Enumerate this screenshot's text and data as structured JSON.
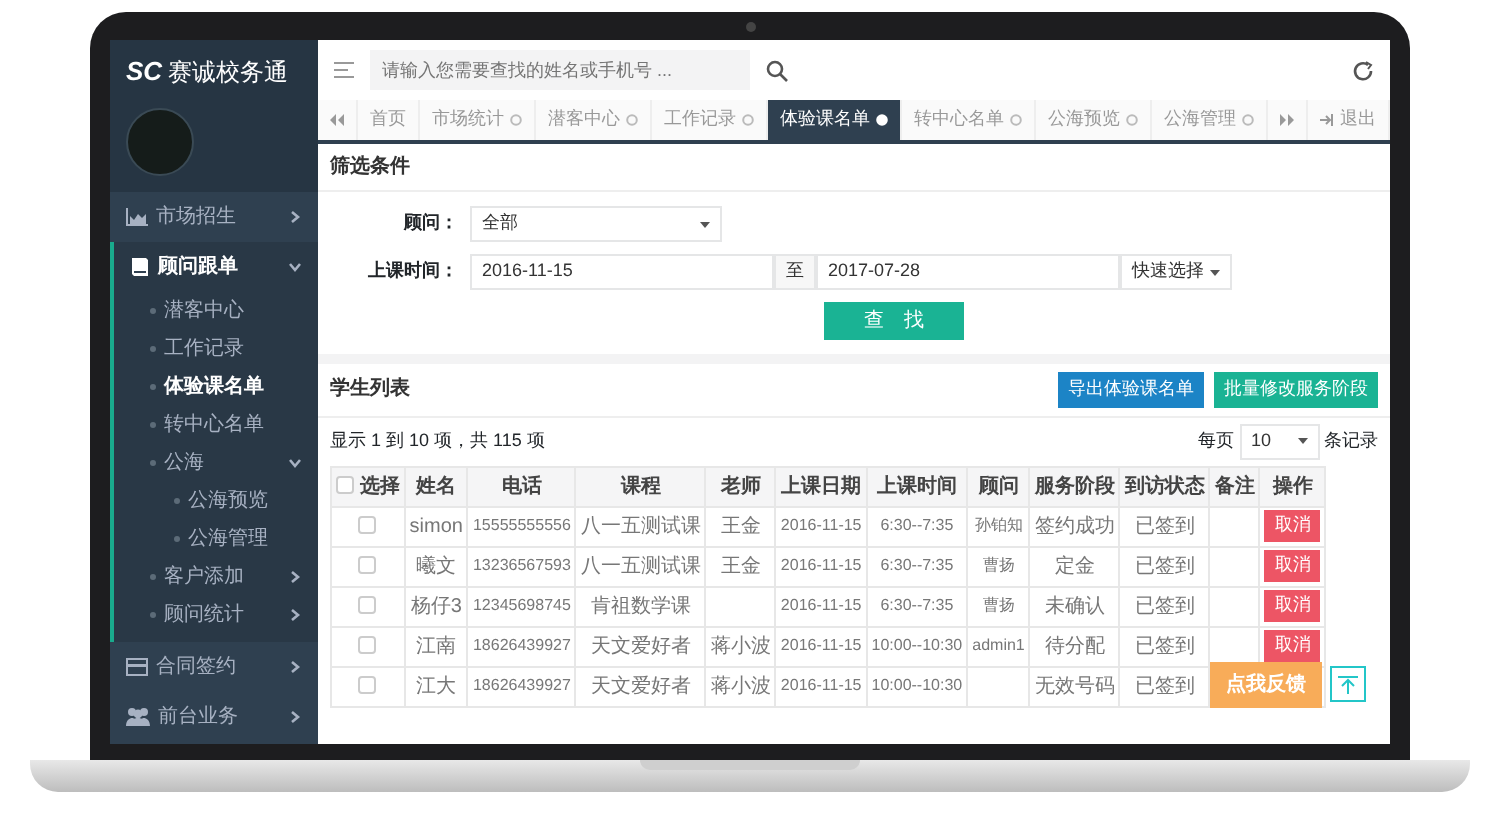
{
  "sidebar": {
    "logo_mark": "SC",
    "app_name": "赛诚校务通",
    "items": [
      {
        "label": "市场招生",
        "kind": "group",
        "expanded": false
      },
      {
        "label": "顾问跟单",
        "kind": "group",
        "expanded": true,
        "children": [
          {
            "label": "潜客中心",
            "selected": false
          },
          {
            "label": "工作记录",
            "selected": false
          },
          {
            "label": "体验课名单",
            "selected": true
          },
          {
            "label": "转中心名单",
            "selected": false
          },
          {
            "label": "公海",
            "expanded": true,
            "selected": false,
            "children": [
              {
                "label": "公海预览",
                "selected": false
              },
              {
                "label": "公海管理",
                "selected": false
              }
            ]
          },
          {
            "label": "客户添加",
            "expanded": false,
            "selected": false
          },
          {
            "label": "顾问统计",
            "expanded": false,
            "selected": false
          }
        ]
      },
      {
        "label": "合同签约",
        "kind": "group",
        "expanded": false
      },
      {
        "label": "前台业务",
        "kind": "group",
        "expanded": false
      }
    ]
  },
  "topbar": {
    "search": {
      "placeholder": "请输入您需要查找的姓名或手机号 ..."
    }
  },
  "tabs": [
    {
      "label": "首页",
      "selected": false,
      "closable": false
    },
    {
      "label": "市场统计",
      "selected": false,
      "closable": true
    },
    {
      "label": "潜客中心",
      "selected": false,
      "closable": true
    },
    {
      "label": "工作记录",
      "selected": false,
      "closable": true
    },
    {
      "label": "体验课名单",
      "selected": true,
      "closable": true
    },
    {
      "label": "转中心名单",
      "selected": false,
      "closable": true
    },
    {
      "label": "公海预览",
      "selected": false,
      "closable": true
    },
    {
      "label": "公海管理",
      "selected": false,
      "closable": true
    }
  ],
  "logout": "退出",
  "filter": {
    "title": "筛选条件",
    "advisor_label": "顾问：",
    "advisor_value": "全部",
    "time_label": "上课时间：",
    "date_from": "2016-11-15",
    "date_sep": "至",
    "date_to": "2017-07-28",
    "quick_select": "快速选择",
    "search_button": "查　找"
  },
  "list": {
    "title": "学生列表",
    "buttons": [
      {
        "label": "导出体验课名单",
        "kind": "primary"
      },
      {
        "label": "批量修改服务阶段",
        "kind": "success"
      }
    ],
    "summary": "显示 1 到 10 项，共 115 项",
    "per_page_label": "每页",
    "per_page": "10",
    "per_page_suffix": "条记录",
    "table": {
      "select_all_checked": false,
      "columns": [
        "选择",
        "姓名",
        "电话",
        "课程",
        "老师",
        "上课日期",
        "上课时间",
        "顾问",
        "服务阶段",
        "到访状态",
        "备注",
        "操作"
      ],
      "rows": [
        {
          "checked": false,
          "name": "simon",
          "phone": "15555555556",
          "course": "八一五测试课",
          "teacher": "王金",
          "date": "2016-11-15",
          "time": "6:30--7:35",
          "advisor": "孙铂知",
          "stage": "签约成功",
          "status": "已签到",
          "action": "取消"
        },
        {
          "checked": false,
          "name": "曦文",
          "phone": "13236567593",
          "course": "八一五测试课",
          "teacher": "王金",
          "date": "2016-11-15",
          "time": "6:30--7:35",
          "advisor": "曹扬",
          "stage": "定金",
          "status": "已签到",
          "action": "取消"
        },
        {
          "checked": false,
          "name": "杨仔3",
          "phone": "12345698745",
          "course": "肯祖数学课",
          "teacher": "",
          "date": "2016-11-15",
          "time": "6:30--7:35",
          "advisor": "曹扬",
          "stage": "未确认",
          "status": "已签到",
          "action": "取消"
        },
        {
          "checked": false,
          "name": "江南",
          "phone": "18626439927",
          "course": "天文爱好者",
          "teacher": "蒋小波",
          "date": "2016-11-15",
          "time": "10:00--10:30",
          "advisor": "admin1",
          "stage": "待分配",
          "status": "已签到",
          "action": "取消"
        },
        {
          "checked": false,
          "name": "江大",
          "phone": "18626439927",
          "course": "天文爱好者",
          "teacher": "蒋小波",
          "date": "2016-11-15",
          "time": "10:00--10:30",
          "advisor": "",
          "stage": "无效号码",
          "status": "已签到",
          "action": ""
        }
      ]
    }
  },
  "feedback_button": "点我反馈"
}
